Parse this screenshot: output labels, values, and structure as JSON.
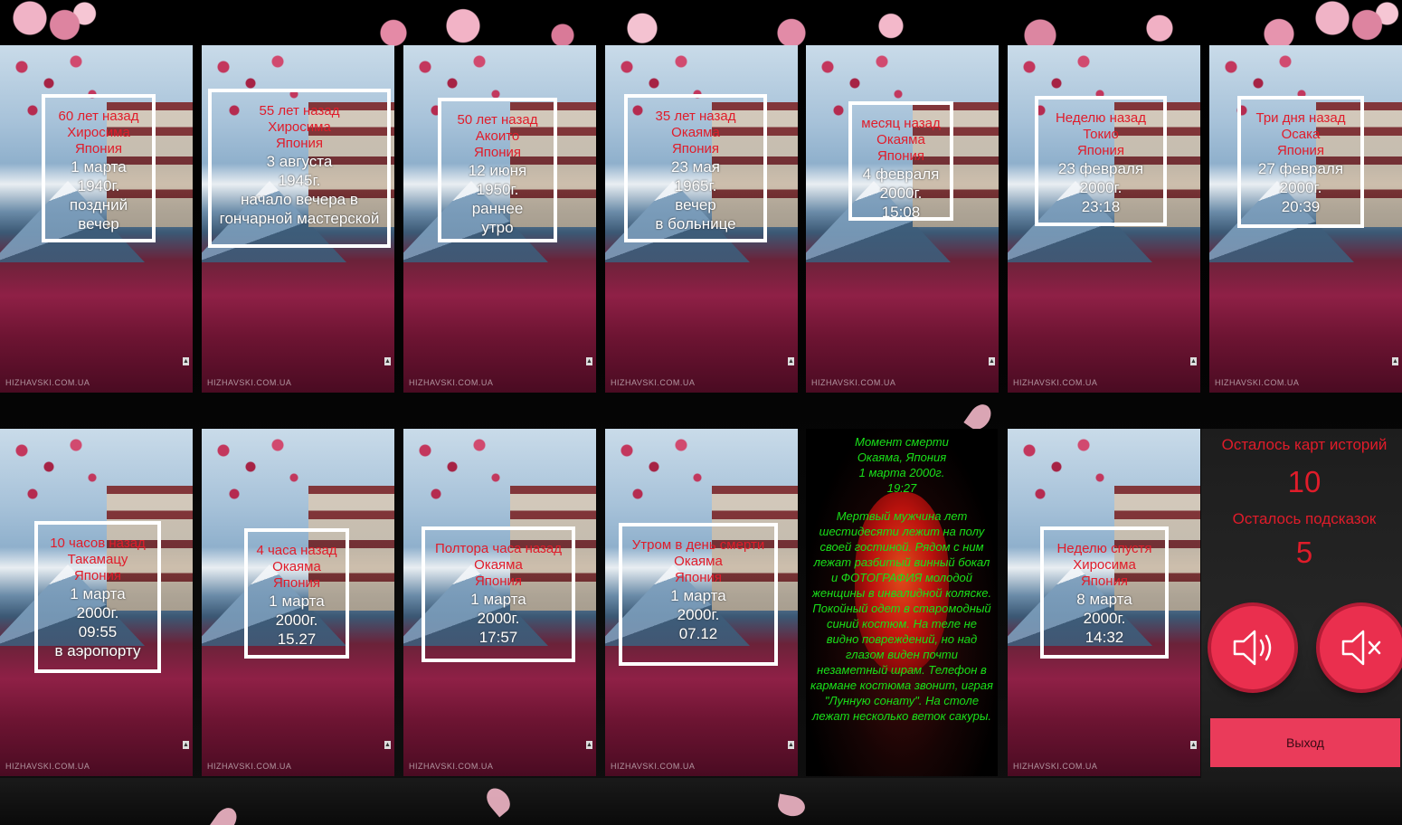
{
  "colors": {
    "accent_red": "#e01c2a",
    "story_green": "#19e01a",
    "button_pink": "#ea2f4e"
  },
  "cards_top": [
    {
      "ago": "60 лет назад",
      "city": "Хиросима",
      "country": "Япония",
      "date": "1 марта",
      "year": "1940г.",
      "time": "поздний",
      "place": "вечер",
      "watermark": "HIZHAVSKI.COM.UA"
    },
    {
      "ago": "55 лет назад",
      "city": "Хиросима",
      "country": "Япония",
      "date": "3 августа",
      "year": "1945г.",
      "time": "начало вечера в",
      "place": "гончарной мастерской",
      "watermark": "HIZHAVSKI.COM.UA"
    },
    {
      "ago": "50 лет назад",
      "city": "Акоито",
      "country": "Япония",
      "date": "12 июня",
      "year": "1950г.",
      "time": "раннее",
      "place": "утро",
      "watermark": "HIZHAVSKI.COM.UA"
    },
    {
      "ago": "35 лет назад",
      "city": "Окаяма",
      "country": "Япония",
      "date": "23 мая",
      "year": "1965г.",
      "time": "вечер",
      "place": "в больнице",
      "watermark": "HIZHAVSKI.COM.UA"
    },
    {
      "ago": "месяц назад",
      "city": "Окаяма",
      "country": "Япония",
      "date": "4 февраля",
      "year": "2000г.",
      "time": "15:08",
      "place": "",
      "watermark": "HIZHAVSKI.COM.UA"
    },
    {
      "ago": "Неделю назад",
      "city": "Токио",
      "country": "Япония",
      "date": "23 февраля",
      "year": "2000г.",
      "time": "23:18",
      "place": "",
      "watermark": "HIZHAVSKI.COM.UA"
    },
    {
      "ago": "Три дня назад",
      "city": "Осака",
      "country": "Япония",
      "date": "27 февраля",
      "year": "2000г.",
      "time": "20:39",
      "place": "",
      "watermark": "HIZHAVSKI.COM.UA"
    }
  ],
  "cards_bottom": [
    {
      "ago": "10 часов назад",
      "city": "Такамацу",
      "country": "Япония",
      "date": "1 марта",
      "year": "2000г.",
      "time": "09:55",
      "place": "в аэропорту",
      "watermark": "HIZHAVSKI.COM.UA"
    },
    {
      "ago": "4 часа назад",
      "city": "Окаяма",
      "country": "Япония",
      "date": "1 марта",
      "year": "2000г.",
      "time": "15.27",
      "place": "",
      "watermark": "HIZHAVSKI.COM.UA"
    },
    {
      "ago": "Полтора часа назад",
      "city": "Окаяма",
      "country": "Япония",
      "date": "1 марта",
      "year": "2000г.",
      "time": "17:57",
      "place": "",
      "watermark": "HIZHAVSKI.COM.UA"
    },
    {
      "ago": "Утром в день смерти",
      "city": "Окаяма",
      "country": "Япония",
      "date": "1 марта",
      "year": "2000г.",
      "time": "07.12",
      "place": "",
      "watermark": "HIZHAVSKI.COM.UA"
    },
    {
      "ago": "Неделю спустя",
      "city": "Хиросима",
      "country": "Япония",
      "date": "8 марта",
      "year": "2000г.",
      "time": "14:32",
      "place": "",
      "watermark": "HIZHAVSKI.COM.UA"
    }
  ],
  "story": {
    "title": "Момент смерти",
    "location": "Окаяма, Япония",
    "date": "1 марта 2000г.",
    "time": "19:27",
    "body": "Мертвый мужчина лет шестидесяти лежит на полу своей гостиной. Рядом с ним лежат разбитый винный бокал и ФОТОГРАФИЯ молодой женщины в инвалидной коляске. Покойный одет в старомодный синий костюм. На теле не видно повреждений, но над глазом виден почти незаметный шрам. Телефон в кармане костюма звонит, играя \"Лунную сонату\". На столе лежат несколько веток сакуры."
  },
  "panel": {
    "cards_left_label": "Осталось карт историй",
    "cards_left_value": "10",
    "hints_left_label": "Осталось подсказок",
    "hints_left_value": "5",
    "sound_on_icon": "speaker-icon",
    "sound_off_icon": "speaker-mute-icon",
    "exit_label": "Выход"
  }
}
